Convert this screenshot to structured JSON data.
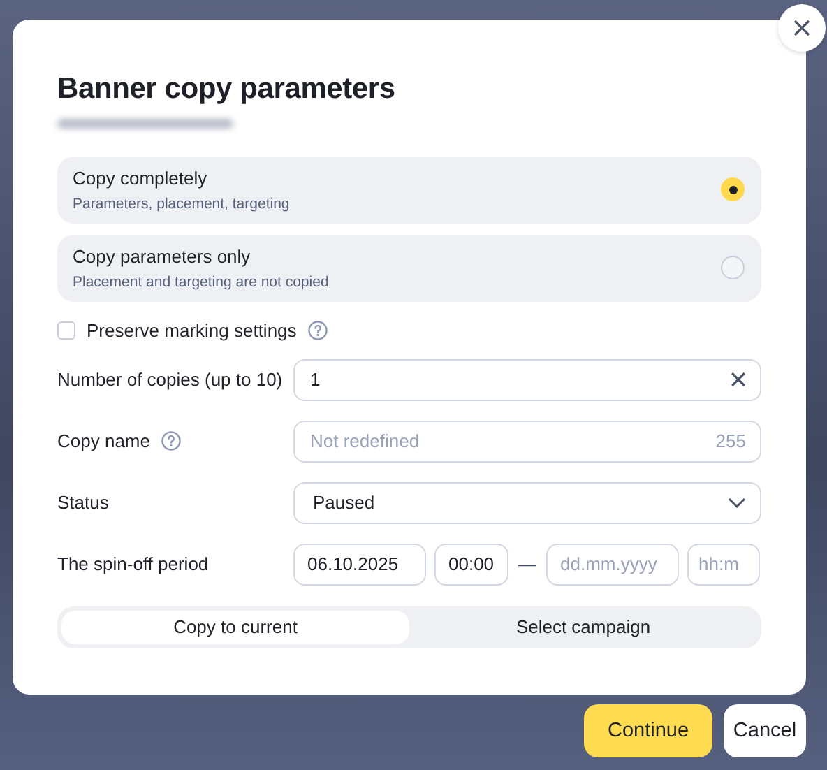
{
  "dialog": {
    "title": "Banner copy parameters"
  },
  "copy_modes": [
    {
      "title": "Copy completely",
      "description": "Parameters, placement, targeting",
      "selected": true
    },
    {
      "title": "Copy parameters only",
      "description": "Placement and targeting are not copied",
      "selected": false
    }
  ],
  "preserve_marking": {
    "label": "Preserve marking settings",
    "checked": false,
    "help": true
  },
  "fields": [
    {
      "kind": "number",
      "label": "Number of copies (up to 10)",
      "value": "1"
    },
    {
      "kind": "text",
      "label": "Copy name",
      "help": true,
      "placeholder": "Not redefined",
      "counter": "255"
    },
    {
      "kind": "select",
      "label": "Status",
      "value": "Paused"
    },
    {
      "kind": "period",
      "label": "The spin-off period",
      "start_date": "06.10.2025",
      "start_time": "00:00",
      "separator": "—",
      "end_date_placeholder": "dd.mm.yyyy",
      "end_time_placeholder": "hh:m"
    }
  ],
  "targets": [
    {
      "label": "Copy to current",
      "selected": true
    },
    {
      "label": "Select campaign",
      "selected": false
    }
  ],
  "buttons": [
    {
      "label": "Continue",
      "kind": "primary"
    },
    {
      "label": "Cancel",
      "kind": "secondary"
    }
  ]
}
